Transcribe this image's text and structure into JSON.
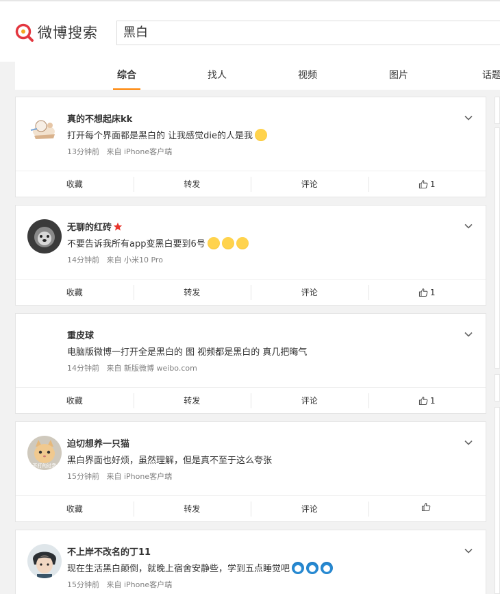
{
  "header": {
    "logo_text": "微博搜索",
    "search_value": "黑白"
  },
  "tabs": [
    {
      "label": "综合",
      "active": true
    },
    {
      "label": "找人"
    },
    {
      "label": "视频"
    },
    {
      "label": "图片"
    },
    {
      "label": "话题"
    }
  ],
  "actions": {
    "collect": "收藏",
    "repost": "转发",
    "comment": "评论"
  },
  "posts": [
    {
      "user": "真的不想起床kk",
      "text": "打开每个界面都是黑白的 让我感觉die的人是我",
      "time": "13分钟前",
      "source": "来自 iPhone客户端",
      "likes": "1"
    },
    {
      "user": "无聊的红砖",
      "text": "不要告诉我所有app变黑白要到6号",
      "time": "14分钟前",
      "source": "来自 小米10 Pro",
      "likes": "1"
    },
    {
      "user": "重皮球",
      "text": "电脑版微博一打开全是黑白的 图 视频都是黑白的 真几把晦气",
      "time": "14分钟前",
      "source": "来自 新版微博 weibo.com",
      "likes": "1"
    },
    {
      "user": "迫切想养一只猫",
      "text": "黑白界面也好烦，虽然理解，但是真不至于这么夸张",
      "time": "15分钟前",
      "source": "来自 iPhone客户端",
      "likes": "",
      "avatar_caption": "不打的过我"
    },
    {
      "user": "不上岸不改名的丁11",
      "text": "现在生活黑白颠倒，就晚上宿舍安静些，学到五点睡觉吧",
      "time": "15分钟前",
      "source": "来自 iPhone客户端",
      "likes": ""
    }
  ],
  "colors": {
    "accent": "#ff8200",
    "logo_red": "#e3373f",
    "star": "#e8352c"
  }
}
